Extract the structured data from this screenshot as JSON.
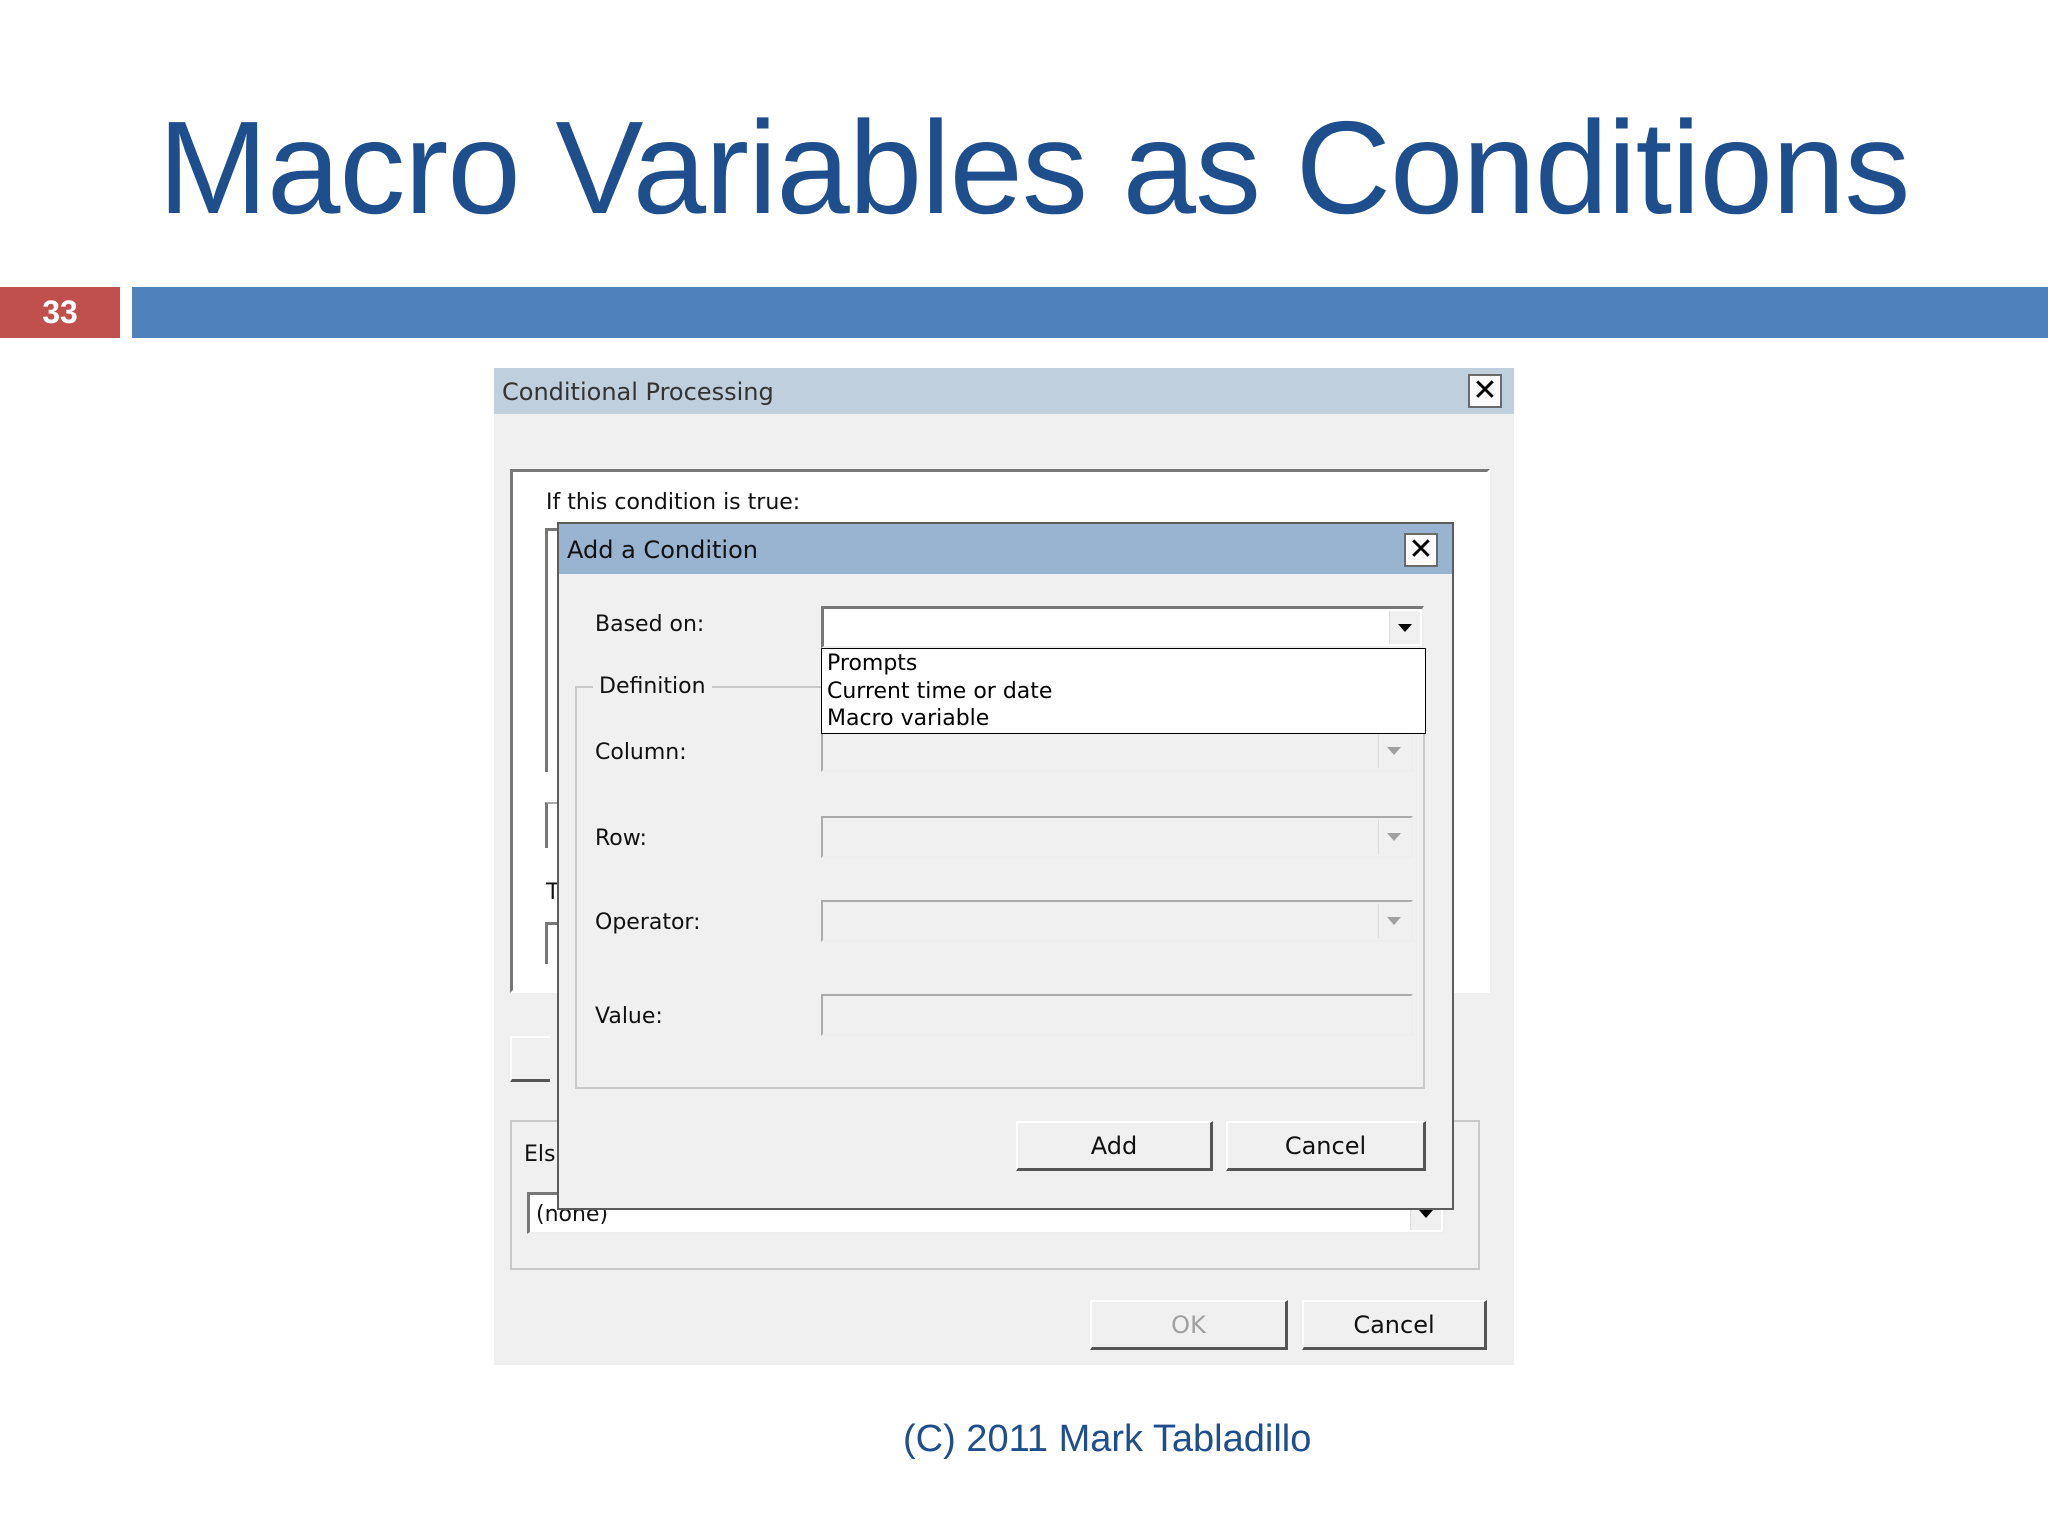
{
  "slide": {
    "title": "Macro Variables as Conditions",
    "page_number": "33",
    "footer": "(C) 2011 Mark Tabladillo",
    "colors": {
      "title": "#1f4e8c",
      "accent_bar": "#4f81bd",
      "page_badge": "#c0504d"
    }
  },
  "outer_dialog": {
    "title": "Conditional Processing",
    "condition_label": "If this condition is true:",
    "then_label_partial": "T",
    "else_label_partial": "Els",
    "else_value": "(none)",
    "ok_label": "OK",
    "cancel_label": "Cancel"
  },
  "inner_dialog": {
    "title": "Add a Condition",
    "based_on_label": "Based on:",
    "based_on_value": "",
    "based_on_options": [
      "Prompts",
      "Current time or date",
      "Macro variable"
    ],
    "definition_group_label": "Definition",
    "column_label": "Column:",
    "row_label": "Row:",
    "operator_label": "Operator:",
    "value_label": "Value:",
    "add_label": "Add",
    "cancel_label": "Cancel"
  }
}
